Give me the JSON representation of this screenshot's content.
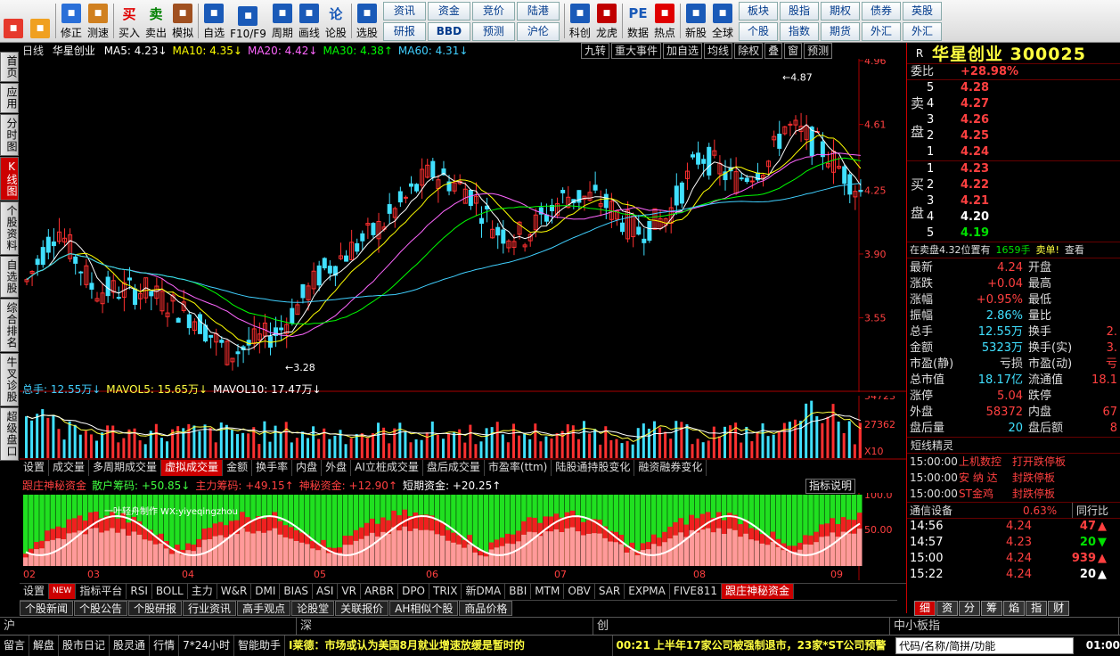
{
  "toolbar": {
    "buttons": [
      {
        "label": "",
        "icon": "home-grid-icon",
        "color": "#e6392c"
      },
      {
        "label": "",
        "icon": "back-arrow-icon",
        "color": "#f0a020"
      },
      {
        "label": "修正",
        "icon": "fix-icon",
        "color": "#2a6fd8"
      },
      {
        "label": "测速",
        "icon": "clock-icon",
        "color": "#d08020"
      },
      {
        "label": "买入",
        "icon": "buy-icon",
        "color": "#e00000",
        "glyph": "买"
      },
      {
        "label": "卖出",
        "icon": "sell-icon",
        "color": "#008000",
        "glyph": "卖"
      },
      {
        "label": "模拟",
        "icon": "hammer-icon",
        "color": "#a05020"
      },
      {
        "label": "自选",
        "icon": "star-icon",
        "color": "#1a5ab8"
      },
      {
        "label": "F10/F9",
        "icon": "f10-icon",
        "color": "#1a5ab8"
      },
      {
        "label": "周期",
        "icon": "period-icon",
        "color": "#1a5ab8"
      },
      {
        "label": "画线",
        "icon": "pen-icon",
        "color": "#1a5ab8"
      },
      {
        "label": "论股",
        "icon": "discuss-icon",
        "color": "#1a5ab8",
        "glyph": "论"
      },
      {
        "label": "选股",
        "icon": "gauge-icon",
        "color": "#1a5ab8"
      }
    ],
    "grid1": [
      "资讯",
      "资金",
      "竞价",
      "陆港",
      "研报",
      "BBD",
      "预测",
      "沪伦"
    ],
    "buttons2": [
      {
        "label": "科创",
        "icon": "chart-icon",
        "color": "#1a5ab8"
      },
      {
        "label": "龙虎",
        "icon": "dragon-icon",
        "color": "#c00000"
      },
      {
        "label": "数据",
        "icon": "pe-icon",
        "color": "#1a5ab8",
        "glyph": "PE"
      },
      {
        "label": "热点",
        "icon": "hot-icon",
        "color": "#e00000"
      },
      {
        "label": "新股",
        "icon": "ipo-icon",
        "color": "#1a5ab8"
      },
      {
        "label": "全球",
        "icon": "globe-icon",
        "color": "#1a5ab8"
      }
    ],
    "grid2": [
      "板块",
      "股指",
      "期权",
      "债券",
      "英股",
      "个股",
      "指数",
      "期货",
      "外汇",
      "外汇"
    ]
  },
  "left_tabs": [
    "首页",
    "应用",
    "分时图",
    "K线图",
    "个股资料",
    "自选股",
    "综合排名",
    "牛叉诊股",
    "超级盘口"
  ],
  "kchart": {
    "period": "日线",
    "name": "华星创业",
    "ma": [
      {
        "t": "MA5: 4.23↓",
        "c": "#ffffff"
      },
      {
        "t": "MA10: 4.35↓",
        "c": "#ffff00"
      },
      {
        "t": "MA20: 4.42↓",
        "c": "#ff66ff"
      },
      {
        "t": "MA30: 4.38↑",
        "c": "#00ff00"
      },
      {
        "t": "MA60: 4.31↓",
        "c": "#40d0ff"
      }
    ],
    "tabs": [
      "九转",
      "重大事件",
      "加自选",
      "均线",
      "除权",
      "叠",
      "窗",
      "预测"
    ],
    "price_axis": [
      "4.96",
      "4.61",
      "4.25",
      "3.90",
      "3.55"
    ],
    "high_label": "4.87",
    "low_label": "3.28"
  },
  "volume": {
    "header": [
      {
        "t": "总手: 12.55万↓",
        "c": "#40d0ff"
      },
      {
        "t": "MAVOL5: 15.65万↓",
        "c": "#ffff40"
      },
      {
        "t": "MAVOL10: 17.47万↓",
        "c": "#ffffff"
      }
    ],
    "axis": [
      "54723",
      "27362",
      "X10"
    ],
    "tabs": [
      "设置",
      "成交量",
      "多周期成交量",
      "虚拟成交量",
      "金额",
      "换手率",
      "内盘",
      "外盘",
      "AI立桩成交量",
      "盘后成交量",
      "市盈率(ttm)",
      "陆股通持股变化",
      "融资融券变化"
    ],
    "selected_tab": "虚拟成交量"
  },
  "indicator": {
    "header": [
      {
        "t": "跟庄神秘资金",
        "c": "#ff4040"
      },
      {
        "t": "散户筹码: +50.85↓",
        "c": "#40ff40"
      },
      {
        "t": "主力筹码: +49.15↑",
        "c": "#ff4040"
      },
      {
        "t": "神秘资金: +12.90↑",
        "c": "#ff4040"
      },
      {
        "t": "短期资金: +20.25↑",
        "c": "#ffffff"
      }
    ],
    "help": "指标说明",
    "axis": [
      "100.0",
      "50.00"
    ],
    "watermark": "一叶轻舟制作    WX:yiyeqingzhou",
    "months": [
      "02",
      "03",
      "04",
      "05",
      "06",
      "07",
      "08",
      "09"
    ]
  },
  "indicator_tabs": [
    "设置",
    "NEW",
    "指标平台",
    "RSI",
    "BOLL",
    "主力",
    "W&R",
    "DMI",
    "BIAS",
    "ASI",
    "VR",
    "ARBR",
    "DPO",
    "TRIX",
    "新DMA",
    "BBI",
    "MTM",
    "OBV",
    "SAR",
    "EXPMA",
    "FIVE811",
    "跟庄神秘资金"
  ],
  "bottom_tabs": [
    "个股新闻",
    "个股公告",
    "个股研报",
    "行业资讯",
    "高手观点",
    "论股堂",
    "关联报价",
    "AH相似个股",
    "商品价格"
  ],
  "market_bar": [
    "沪",
    "深",
    "创",
    "中小板指"
  ],
  "sidebar": {
    "title": "华星创业 300025",
    "webi_label": "委比",
    "webi_value": "+28.98%",
    "sell_label": "卖盘",
    "buy_label": "买盘",
    "sell": [
      {
        "n": "5",
        "p": "4.28"
      },
      {
        "n": "4",
        "p": "4.27"
      },
      {
        "n": "3",
        "p": "4.26"
      },
      {
        "n": "2",
        "p": "4.25"
      },
      {
        "n": "1",
        "p": "4.24"
      }
    ],
    "buy": [
      {
        "n": "1",
        "p": "4.23",
        "c": "#ff4040"
      },
      {
        "n": "2",
        "p": "4.22",
        "c": "#ff4040"
      },
      {
        "n": "3",
        "p": "4.21",
        "c": "#ff4040"
      },
      {
        "n": "4",
        "p": "4.20",
        "c": "#ffffff"
      },
      {
        "n": "5",
        "p": "4.19",
        "c": "#00e000"
      }
    ],
    "notice": [
      "在卖盘4.32位置有",
      "1659手",
      "卖单!",
      "查看"
    ],
    "quote": [
      [
        "最新",
        "4.24",
        "#ff4040",
        "开盘",
        ""
      ],
      [
        "涨跌",
        "+0.04",
        "#ff4040",
        "最高",
        ""
      ],
      [
        "涨幅",
        "+0.95%",
        "#ff4040",
        "最低",
        ""
      ],
      [
        "振幅",
        "2.86%",
        "#40e0ff",
        "量比",
        ""
      ],
      [
        "总手",
        "12.55万",
        "#40e0ff",
        "换手",
        "2."
      ],
      [
        "金额",
        "5323万",
        "#40e0ff",
        "换手(实)",
        "3."
      ],
      [
        "市盈(静)",
        "亏损",
        "#dddddd",
        "市盈(动)",
        "亏"
      ],
      [
        "总市值",
        "18.17亿",
        "#40e0ff",
        "流通值",
        "18.1"
      ],
      [
        "涨停",
        "5.04",
        "#ff4040",
        "跌停",
        ""
      ],
      [
        "外盘",
        "58372",
        "#ff4040",
        "内盘",
        "67"
      ],
      [
        "盘后量",
        "20",
        "#40e0ff",
        "盘后额",
        "8"
      ]
    ],
    "elf_title": "短线精灵",
    "elf": [
      [
        "15:00:00",
        "上机数控",
        "打开跌停板"
      ],
      [
        "15:00:00",
        "安 纳 达",
        "封跌停板"
      ],
      [
        "15:00:00",
        "ST金鸡",
        "封跌停板"
      ]
    ],
    "industry": [
      "通信设备",
      "0.63%",
      "同行比"
    ],
    "ticks": [
      [
        "14:56",
        "4.24",
        "47",
        "up"
      ],
      [
        "14:57",
        "4.23",
        "20",
        "down"
      ],
      [
        "15:00",
        "4.24",
        "939",
        "up"
      ],
      [
        "15:22",
        "4.24",
        "20",
        "up"
      ]
    ],
    "tabs": [
      "细",
      "资",
      "分",
      "筹",
      "焰",
      "指",
      "财"
    ]
  },
  "status": {
    "items": [
      "留言",
      "解盘",
      "股市日记",
      "股灵通",
      "行情",
      "7*24小时",
      "智能助手"
    ],
    "news1": "I莱德：市场或认为美国8月就业增速放缓是暂时的",
    "news2": "00:21 上半年17家公司被强制退市，23家*ST公司预警",
    "search": "代码/名称/简拼/功能",
    "clock": "01:00"
  }
}
